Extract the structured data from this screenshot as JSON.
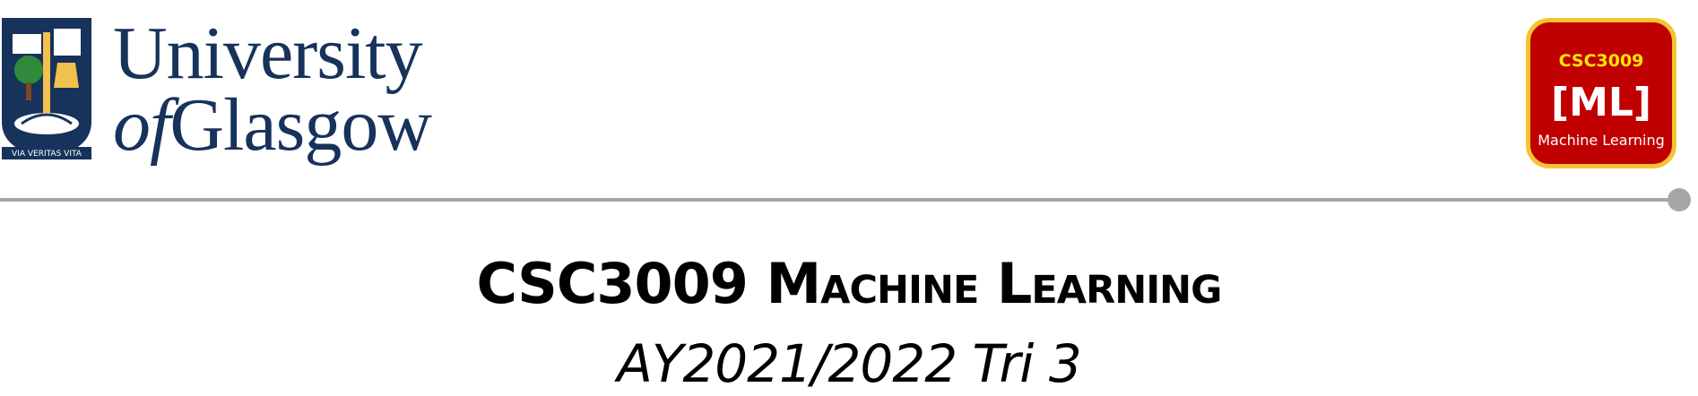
{
  "logo": {
    "crest_motto": "VIA VERITAS VITA",
    "line1": "University",
    "line2_of": "of",
    "line2_name": "Glasgow"
  },
  "badge": {
    "code": "CSC3009",
    "abbr": "[ML]",
    "name": "Machine Learning"
  },
  "document": {
    "title": "CSC3009 Machine Learning",
    "subtitle": "AY2021/2022 Tri 3"
  },
  "colors": {
    "logo_navy": "#17325b",
    "badge_red": "#c00000",
    "badge_border": "#f4c430",
    "badge_code": "#ffe600",
    "rule_gray": "#a6a6a6"
  }
}
